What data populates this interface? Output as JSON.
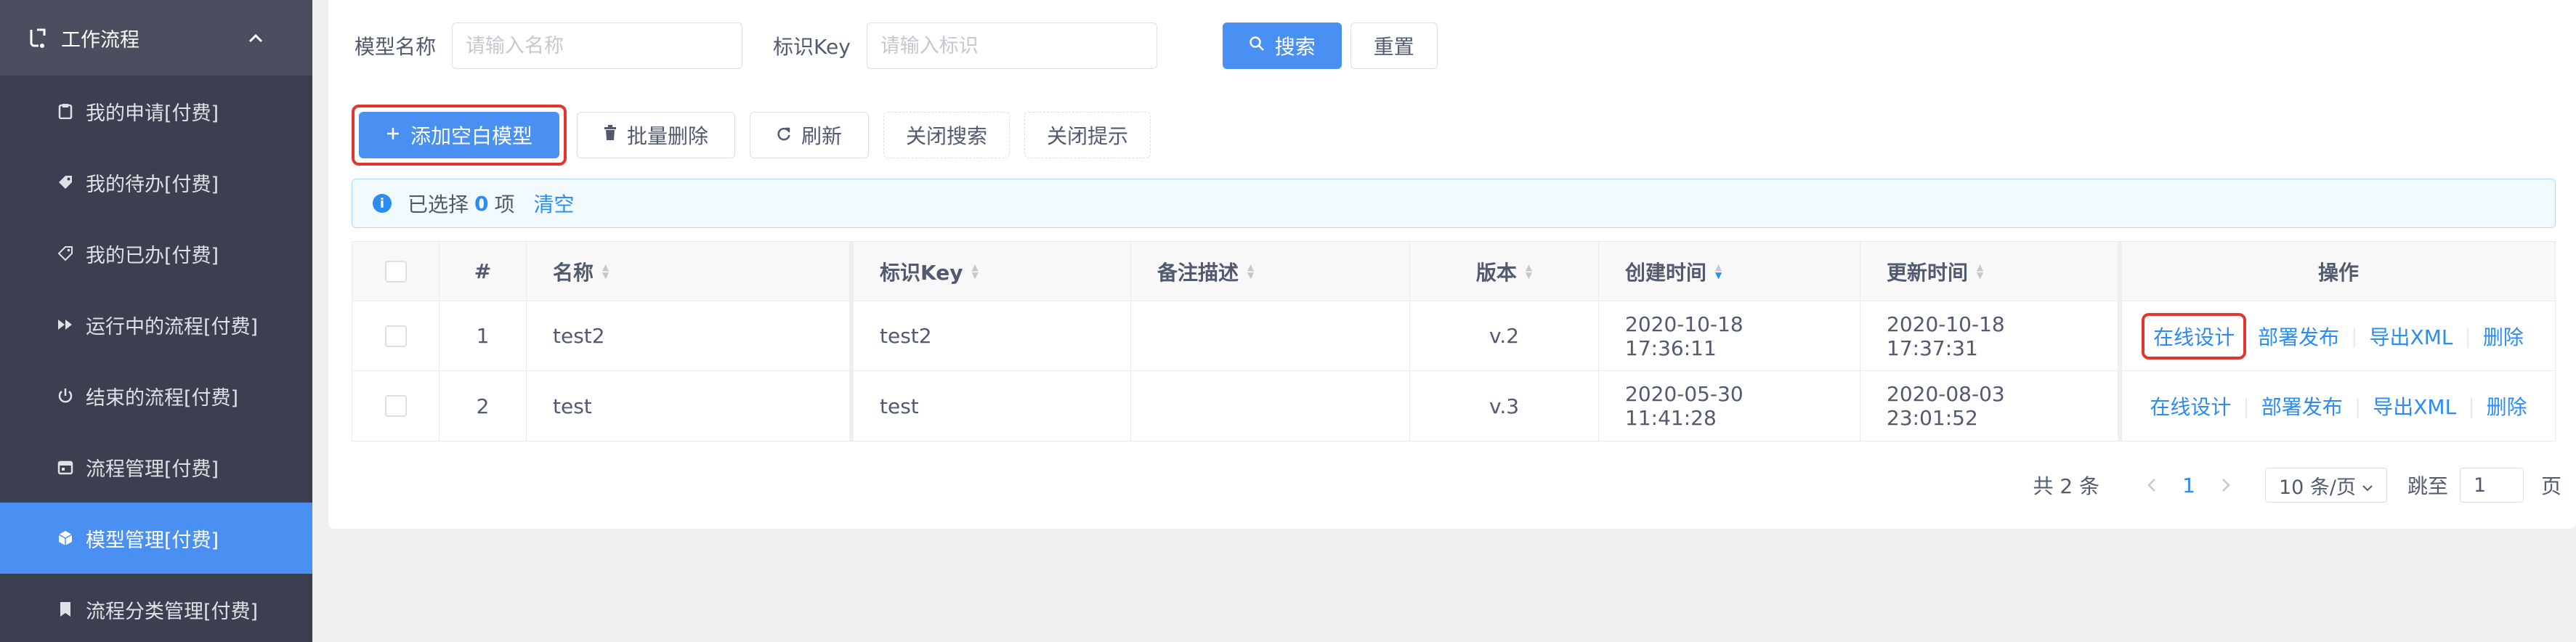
{
  "sidebar": {
    "header": "工作流程",
    "items": [
      {
        "label": "我的申请[付费]",
        "icon": "clipboard-icon"
      },
      {
        "label": "我的待办[付费]",
        "icon": "tag-icon"
      },
      {
        "label": "我的已办[付费]",
        "icon": "tag-outline-icon"
      },
      {
        "label": "运行中的流程[付费]",
        "icon": "fast-forward-icon"
      },
      {
        "label": "结束的流程[付费]",
        "icon": "power-icon"
      },
      {
        "label": "流程管理[付费]",
        "icon": "calendar-icon"
      },
      {
        "label": "模型管理[付费]",
        "icon": "cube-icon",
        "active": true
      },
      {
        "label": "流程分类管理[付费]",
        "icon": "bookmark-icon"
      }
    ]
  },
  "search": {
    "name_label": "模型名称",
    "name_placeholder": "请输入名称",
    "key_label": "标识Key",
    "key_placeholder": "请输入标识",
    "search_button": "搜索",
    "reset_button": "重置"
  },
  "toolbar": {
    "add": "添加空白模型",
    "batch_delete": "批量删除",
    "refresh": "刷新",
    "close_search": "关闭搜索",
    "close_tip": "关闭提示"
  },
  "alert": {
    "prefix": "已选择",
    "count": "0",
    "suffix": "项",
    "clear": "清空"
  },
  "table": {
    "columns": {
      "index": "#",
      "name": "名称",
      "key": "标识Key",
      "desc": "备注描述",
      "version": "版本",
      "created": "创建时间",
      "updated": "更新时间",
      "ops": "操作"
    },
    "rows": [
      {
        "index": "1",
        "name": "test2",
        "key": "test2",
        "desc": "",
        "version": "v.2",
        "created": "2020-10-18 17:36:11",
        "updated": "2020-10-18 17:37:31"
      },
      {
        "index": "2",
        "name": "test",
        "key": "test",
        "desc": "",
        "version": "v.3",
        "created": "2020-05-30 11:41:28",
        "updated": "2020-08-03 23:01:52"
      }
    ],
    "actions": {
      "design": "在线设计",
      "deploy": "部署发布",
      "export": "导出XML",
      "delete": "删除"
    }
  },
  "pager": {
    "total": "共 2 条",
    "current": "1",
    "page_size": "10 条/页",
    "jump_label": "跳至",
    "jump_value": "1",
    "page_unit": "页"
  },
  "colors": {
    "primary": "#4a90f2",
    "sidebar_bg": "#3b3f4f",
    "highlight": "#e0382e"
  }
}
